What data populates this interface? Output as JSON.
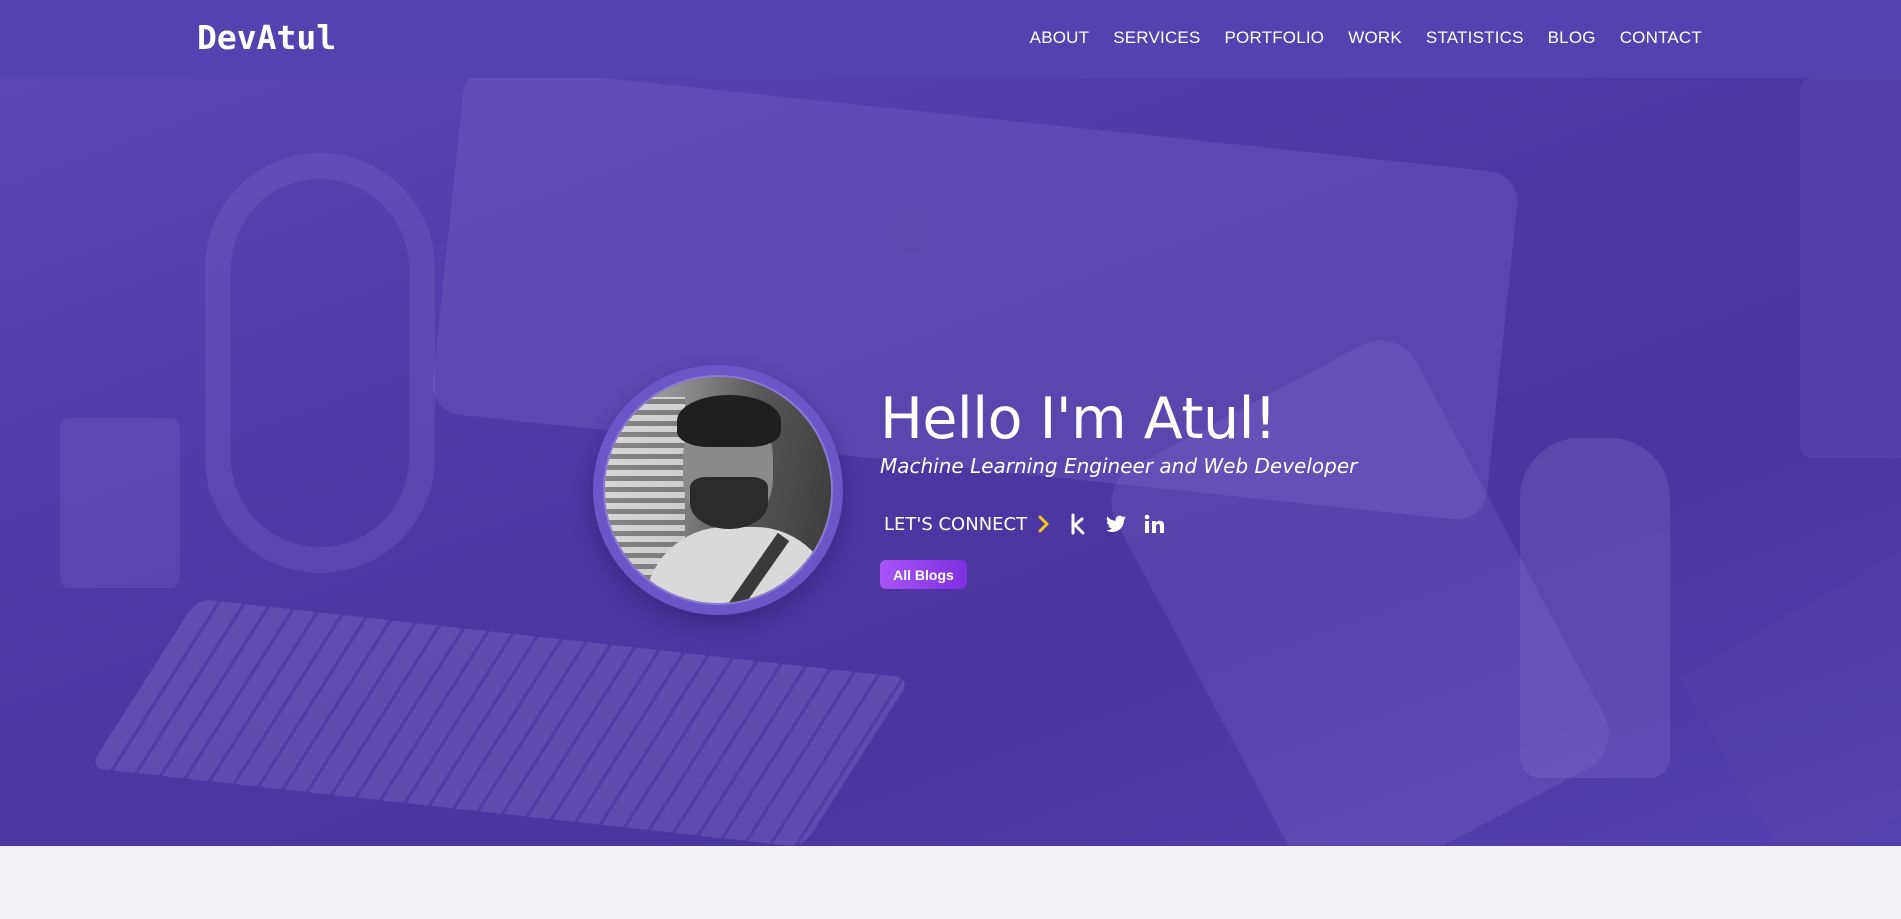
{
  "nav": {
    "brand": "DevAtul",
    "links": [
      "ABOUT",
      "SERVICES",
      "PORTFOLIO",
      "WORK",
      "STATISTICS",
      "BLOG",
      "CONTACT"
    ]
  },
  "hero": {
    "headline": "Hello I'm Atul!",
    "subtitle": "Machine Learning Engineer and Web Developer",
    "connect_label": "LET'S CONNECT",
    "social_icons": [
      "kaggle-icon",
      "twitter-icon",
      "linkedin-icon"
    ],
    "cta_label": "All Blogs"
  },
  "colors": {
    "navbar": "#5442b0",
    "hero_overlay": "#4c37a3",
    "accent_chevron": "#f5c518",
    "cta_gradient_start": "#a855f7",
    "cta_gradient_end": "#7e2fe0",
    "page_background": "#f3f2f7"
  }
}
